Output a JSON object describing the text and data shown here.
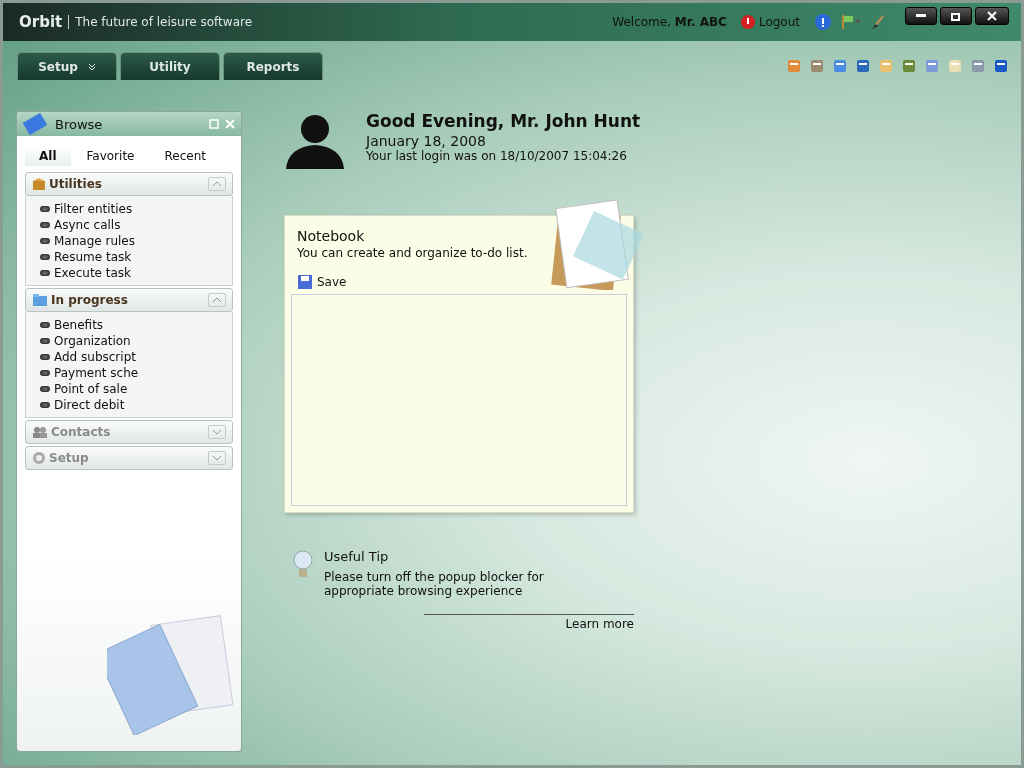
{
  "header": {
    "logo": "Orbit",
    "tagline": "The future of leisure software",
    "welcome": "Welcome, **Mr. ABC**",
    "logout": "Logout"
  },
  "menu_tabs": [
    {
      "label": "Setup",
      "has_dropdown": true
    },
    {
      "label": "Utility",
      "has_dropdown": false
    },
    {
      "label": "Reports",
      "has_dropdown": false
    }
  ],
  "browse": {
    "title": "Browse",
    "tabs": [
      {
        "label": "All",
        "selected": true
      },
      {
        "label": "Favorite",
        "selected": false
      },
      {
        "label": "Recent",
        "selected": false
      }
    ],
    "sections": [
      {
        "kind": "utilities",
        "title": "Utilities",
        "expanded": true,
        "items": [
          "Filter entities",
          "Async calls",
          "Manage rules",
          "Resume task",
          "Execute task"
        ]
      },
      {
        "kind": "progress",
        "title": "In progress",
        "expanded": true,
        "items": [
          "Benefits",
          "Organization",
          "Add subscript",
          "Payment sche",
          "Point of sale",
          "Direct debit"
        ]
      },
      {
        "kind": "contacts",
        "title": "Contacts",
        "expanded": false
      },
      {
        "kind": "setup",
        "title": "Setup",
        "expanded": false
      }
    ]
  },
  "greeting": {
    "title": "Good Evening, Mr. John Hunt",
    "date": "January 18, 2008",
    "last_login": "Your last login was on 18/10/2007 15:04:26"
  },
  "notebook": {
    "title": "Notebook",
    "description": "You can create and organize to-do list.",
    "save": "Save"
  },
  "tip": {
    "title": "Useful Tip",
    "text": "Please turn off the popup blocker for appropriate browsing experience",
    "link": "Learn more"
  }
}
